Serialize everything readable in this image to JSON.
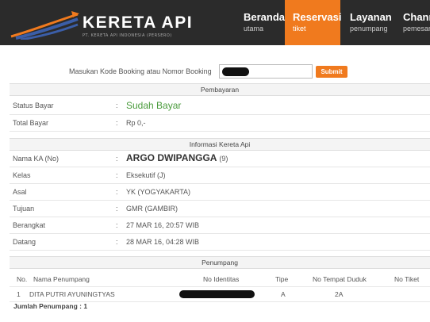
{
  "header": {
    "logo_text": "KERETA API",
    "logo_sub": "PT. KERETA API INDONESIA (PERSERO)",
    "colors": {
      "bar": "#2b2b2b",
      "accent": "#f07a1e"
    },
    "nav": [
      {
        "title": "Beranda",
        "sub": "utama"
      },
      {
        "title": "Reservasi",
        "sub": "tiket"
      },
      {
        "title": "Layanan",
        "sub": "penumpang"
      },
      {
        "title": "Channel",
        "sub": "pemesanan"
      }
    ]
  },
  "search": {
    "label": "Masukan Kode Booking atau Nomor Booking",
    "submit_label": "Submit"
  },
  "pembayaran": {
    "header": "Pembayaran",
    "rows": [
      {
        "label": "Status Bayar",
        "colon": ":",
        "value": "Sudah Bayar"
      },
      {
        "label": "Total Bayar",
        "colon": ":",
        "value": "Rp 0,-"
      }
    ]
  },
  "kereta": {
    "header": "Informasi Kereta Api",
    "nama_label": "Nama KA (No)",
    "nama_value": "ARGO DWIPANGGA",
    "nama_no": "(9)",
    "colon": ":",
    "rows": [
      {
        "label": "Kelas",
        "value": "Eksekutif (J)"
      },
      {
        "label": "Asal",
        "value": "YK (YOGYAKARTA)"
      },
      {
        "label": "Tujuan",
        "value": "GMR (GAMBIR)"
      },
      {
        "label": "Berangkat",
        "value": "27 MAR 16, 20:57 WIB"
      },
      {
        "label": "Datang",
        "value": "28 MAR 16, 04:28 WIB"
      }
    ]
  },
  "penumpang": {
    "header": "Penumpang",
    "columns": [
      "No.",
      "Nama Penumpang",
      "No Identitas",
      "Tipe",
      "No Tempat Duduk",
      "No Tiket"
    ],
    "rows": [
      {
        "no": "1",
        "nama": "DITA PUTRI AYUNINGTYAS",
        "tipe": "A",
        "tempat": "2A",
        "tiket": ""
      }
    ],
    "total": "Jumlah Penumpang : 1"
  }
}
